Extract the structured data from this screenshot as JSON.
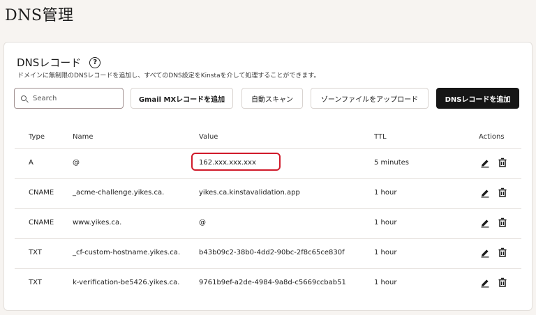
{
  "page": {
    "title": "DNS管理"
  },
  "section": {
    "title": "DNSレコード",
    "help_glyph": "?",
    "description": "ドメインに無制限のDNSレコードを追加し、すべてのDNS設定をKinstaを介して処理することができます。"
  },
  "toolbar": {
    "search_placeholder": "Search",
    "gmail_button": "Gmail MXレコードを追加",
    "scan_button": "自動スキャン",
    "upload_button": "ゾーンファイルをアップロード",
    "add_button": "DNSレコードを追加"
  },
  "table": {
    "headers": {
      "type": "Type",
      "name": "Name",
      "value": "Value",
      "ttl": "TTL",
      "actions": "Actions"
    },
    "rows": [
      {
        "type": "A",
        "name": "@",
        "value": "162.xxx.xxx.xxx",
        "ttl": "5 minutes"
      },
      {
        "type": "CNAME",
        "name": "_acme-challenge.yikes.ca.",
        "value": "yikes.ca.kinstavalidation.app",
        "ttl": "1 hour"
      },
      {
        "type": "CNAME",
        "name": "www.yikes.ca.",
        "value": "@",
        "ttl": "1 hour"
      },
      {
        "type": "TXT",
        "name": "_cf-custom-hostname.yikes.ca.",
        "value": "b43b09c2-38b0-4dd2-90bc-2f8c65ce830f",
        "ttl": "1 hour"
      },
      {
        "type": "TXT",
        "name": "k-verification-be5426.yikes.ca.",
        "value": "9761b9ef-a2de-4984-9a8d-c5669ccbab51",
        "ttl": "1 hour"
      }
    ]
  },
  "icons": {
    "edit": "pencil-icon",
    "delete": "trash-icon",
    "search": "search-icon",
    "help": "help-circle-icon"
  },
  "colors": {
    "highlight": "#d01a2a",
    "primary_button": "#161616",
    "background": "#f7f4f1"
  }
}
